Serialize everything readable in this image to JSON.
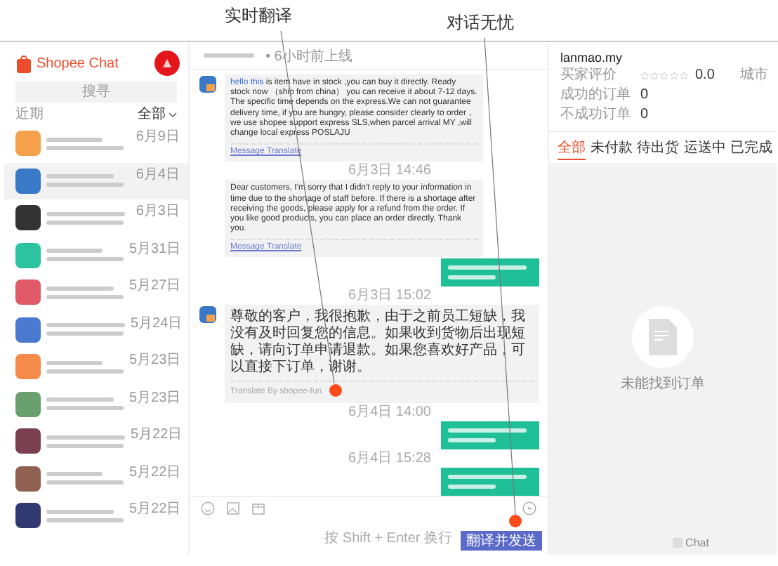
{
  "annotations": [
    {
      "label": "实时翻译"
    },
    {
      "label": "对话无忧"
    }
  ],
  "sidebar": {
    "brand": "Shopee Chat",
    "search": {
      "placeholder": "搜寻"
    },
    "section": "近期",
    "filter": "全部",
    "chats": [
      {
        "date": "6月9日",
        "color": "#f5a04a",
        "selected": false
      },
      {
        "date": "6月4日",
        "color": "#3a78c8",
        "selected": true
      },
      {
        "date": "6月3日",
        "color": "#333333",
        "selected": false
      },
      {
        "date": "5月31日",
        "color": "#2cc4a0",
        "selected": false
      },
      {
        "date": "5月27日",
        "color": "#e05a6a",
        "selected": false
      },
      {
        "date": "5月24日",
        "color": "#4a7ad0",
        "selected": false
      },
      {
        "date": "5月23日",
        "color": "#f58a4a",
        "selected": false
      },
      {
        "date": "5月23日",
        "color": "#6aa070",
        "selected": false
      },
      {
        "date": "5月22日",
        "color": "#7a4050",
        "selected": false
      },
      {
        "date": "5月22日",
        "color": "#906050",
        "selected": false
      },
      {
        "date": "5月22日",
        "color": "#303a70",
        "selected": false
      }
    ]
  },
  "conversation": {
    "status": "• 6小时前上线",
    "messages": [
      {
        "kind": "incoming",
        "avatar": true,
        "link": "hello this",
        "text": "is item  have in stock ,you can buy it directly. Ready stock now （ship from china） you can receive it about 7-12 days. The specific time depends on the express.We can not guarantee delivery time, if you are hungry, please consider clearly to order， we use shopee support express SLS,when parcel arrival MY ,will change local express POSLAJU",
        "footer": "Message Translate"
      },
      {
        "kind": "time",
        "text": "6月3日 14:46"
      },
      {
        "kind": "incoming",
        "avatar": false,
        "text": "Dear customers, I'm sorry that I didn't reply to your information in time due to the shortage of staff before. If there is a shortage after receiving the goods, please apply for a refund from the order. If you like good products, you can place an order directly. Thank you.",
        "footer": "Message Translate"
      },
      {
        "kind": "outgoing"
      },
      {
        "kind": "time",
        "text": "6月3日 15:02"
      },
      {
        "kind": "incoming",
        "avatar": true,
        "text": "尊敬的客户，我很抱歉，由于之前员工短缺，我没有及时回复您的信息。如果收到货物后出现短缺，请向订单申请退款。如果您喜欢好产品，可以直接下订单，谢谢。",
        "note": "Translate By shopee-fun"
      },
      {
        "kind": "time",
        "text": "6月4日 14:00"
      },
      {
        "kind": "outgoing"
      },
      {
        "kind": "time",
        "text": "6月4日 15:28"
      },
      {
        "kind": "outgoing"
      }
    ],
    "hint": "按 Shift + Enter 换行",
    "send": "翻译并发送"
  },
  "buyer": {
    "name": "lanmao.my",
    "rating_label": "买家评价",
    "stars": 0,
    "rating": "0.0",
    "city": "城市",
    "stats": [
      {
        "label": "成功的订单",
        "value": "0"
      },
      {
        "label": "不成功订单",
        "value": "0"
      }
    ],
    "tabs": [
      {
        "label": "全部",
        "selected": true
      },
      {
        "label": "未付款",
        "selected": false
      },
      {
        "label": "待出货",
        "selected": false
      },
      {
        "label": "运送中",
        "selected": false
      },
      {
        "label": "已完成",
        "selected": false
      }
    ],
    "empty": "未能找到订单",
    "footer": "Chat"
  }
}
